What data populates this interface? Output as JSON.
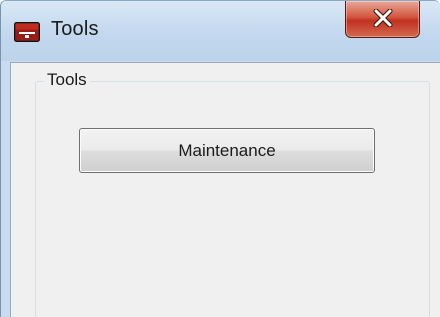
{
  "window": {
    "title": "Tools",
    "icon": "tools-app-icon",
    "close_icon": "close-icon",
    "close_color": "#c0321f"
  },
  "group": {
    "label": "Tools"
  },
  "buttons": {
    "maintenance_label": "Maintenance"
  }
}
